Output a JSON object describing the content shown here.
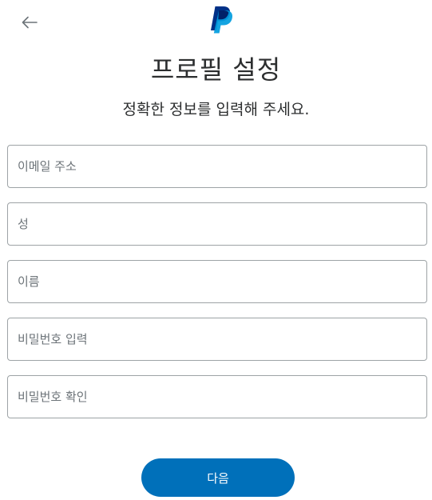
{
  "header": {
    "back_icon": "arrow-left-icon",
    "logo_icon": "paypal-logo-icon",
    "title": "프로필 설정",
    "subtitle": "정확한 정보를 입력해 주세요."
  },
  "form": {
    "fields": [
      {
        "name": "email",
        "placeholder": "이메일 주소",
        "value": ""
      },
      {
        "name": "last_name",
        "placeholder": "성",
        "value": ""
      },
      {
        "name": "first_name",
        "placeholder": "이름",
        "value": ""
      },
      {
        "name": "password",
        "placeholder": "비밀번호 입력",
        "value": ""
      },
      {
        "name": "password_confirm",
        "placeholder": "비밀번호 확인",
        "value": ""
      }
    ],
    "submit_label": "다음"
  },
  "colors": {
    "brand_blue": "#0070ba",
    "logo_dark": "#003087",
    "logo_light": "#009cde",
    "field_border": "#9da3a6"
  }
}
